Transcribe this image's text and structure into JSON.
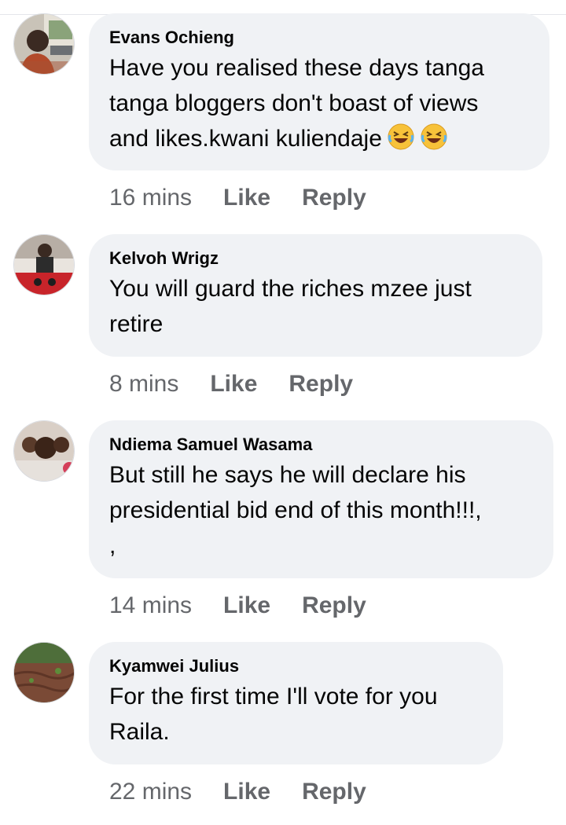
{
  "comments": [
    {
      "author": "Evans Ochieng",
      "lines": [
        "Have you realised these days tanga",
        "tanga bloggers don't boast of views",
        "and likes.kwani kuliendaje"
      ],
      "emoji": [
        "rolling-on-floor-laughing-emoji",
        "rolling-on-floor-laughing-emoji"
      ],
      "time": "16 mins",
      "like": "Like",
      "reply": "Reply"
    },
    {
      "author": "Kelvoh Wrigz",
      "lines": [
        "You will guard the riches mzee just",
        "retire"
      ],
      "time": "8 mins",
      "like": "Like",
      "reply": "Reply"
    },
    {
      "author": "Ndiema Samuel Wasama",
      "lines": [
        "But still he says he will declare his",
        "presidential bid end of this month!!!,",
        ","
      ],
      "time": "14 mins",
      "like": "Like",
      "reply": "Reply"
    },
    {
      "author": "Kyamwei Julius",
      "lines": [
        "For the first time I'll vote for you",
        "Raila."
      ],
      "time": "22 mins",
      "like": "Like",
      "reply": "Reply"
    }
  ],
  "colors": {
    "bubble": "#f0f2f5",
    "text": "#050505",
    "secondary": "#65676b"
  }
}
